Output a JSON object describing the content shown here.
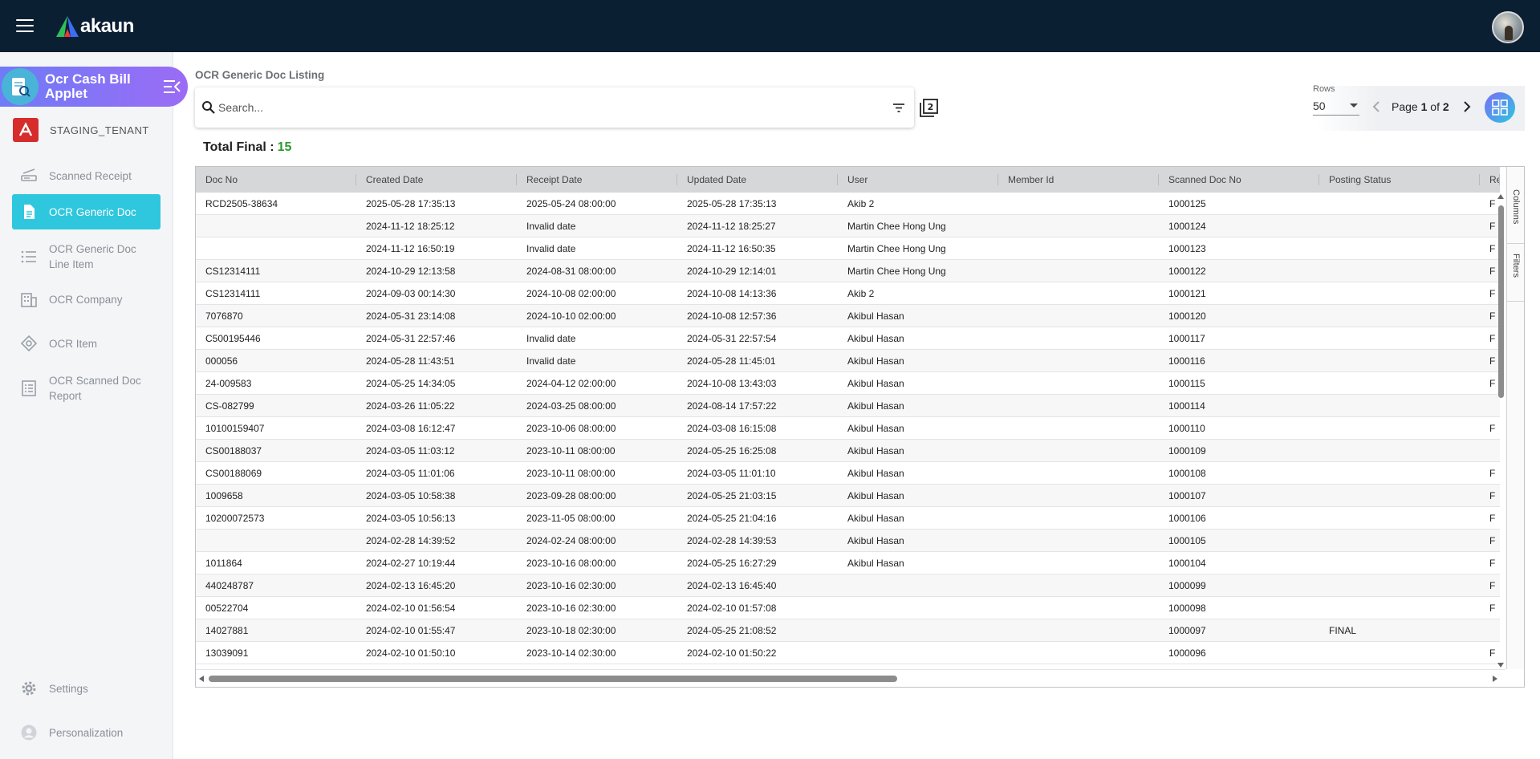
{
  "topbar": {
    "brand": "akaun",
    "colors": {
      "background": "#0b1f33",
      "accent": "#2ec7de"
    }
  },
  "sidebar": {
    "applet_title": "Ocr Cash Bill Applet",
    "tenant": "STAGING_TENANT",
    "items": [
      {
        "label": "Scanned Receipt",
        "icon": "scanner-icon"
      },
      {
        "label": "OCR Generic Doc",
        "icon": "document-icon",
        "active": true
      },
      {
        "label": "OCR Generic Doc Line Item",
        "icon": "list-icon"
      },
      {
        "label": "OCR Company",
        "icon": "building-icon"
      },
      {
        "label": "OCR Item",
        "icon": "item-icon"
      },
      {
        "label": "OCR Scanned Doc Report",
        "icon": "report-icon"
      }
    ],
    "bottom": [
      {
        "label": "Settings",
        "icon": "gear-icon"
      },
      {
        "label": "Personalization",
        "icon": "person-icon"
      }
    ]
  },
  "main": {
    "page_title": "OCR Generic Doc Listing",
    "search_placeholder": "Search...",
    "rows_label": "Rows",
    "rows_value": "50",
    "page_prefix": "Page",
    "page_current": "1",
    "page_of": "of",
    "page_total": "2",
    "total_final_label": "Total Final :",
    "total_final_count": "15"
  },
  "grid": {
    "columns": [
      "Doc No",
      "Created Date",
      "Receipt Date",
      "Updated Date",
      "User",
      "Member Id",
      "Scanned Doc No",
      "Posting Status",
      "Rea"
    ],
    "side_tabs": {
      "columns": "Columns",
      "filters": "Filters"
    },
    "rows": [
      [
        "RCD2505-38634",
        "2025-05-28 17:35:13",
        "2025-05-24 08:00:00",
        "2025-05-28 17:35:13",
        "Akib 2",
        "",
        "1000125",
        "",
        "F"
      ],
      [
        "",
        "2024-11-12 18:25:12",
        "Invalid date",
        "2024-11-12 18:25:27",
        "Martin Chee Hong Ung",
        "",
        "1000124",
        "",
        "F"
      ],
      [
        "",
        "2024-11-12 16:50:19",
        "Invalid date",
        "2024-11-12 16:50:35",
        "Martin Chee Hong Ung",
        "",
        "1000123",
        "",
        "F"
      ],
      [
        "CS12314111",
        "2024-10-29 12:13:58",
        "2024-08-31 08:00:00",
        "2024-10-29 12:14:01",
        "Martin Chee Hong Ung",
        "",
        "1000122",
        "",
        "F"
      ],
      [
        "CS12314111",
        "2024-09-03 00:14:30",
        "2024-10-08 02:00:00",
        "2024-10-08 14:13:36",
        "Akib 2",
        "",
        "1000121",
        "",
        "F"
      ],
      [
        "7076870",
        "2024-05-31 23:14:08",
        "2024-10-10 02:00:00",
        "2024-10-08 12:57:36",
        "Akibul Hasan",
        "",
        "1000120",
        "",
        "F"
      ],
      [
        "C500195446",
        "2024-05-31 22:57:46",
        "Invalid date",
        "2024-05-31 22:57:54",
        "Akibul Hasan",
        "",
        "1000117",
        "",
        "F"
      ],
      [
        "000056",
        "2024-05-28 11:43:51",
        "Invalid date",
        "2024-05-28 11:45:01",
        "Akibul Hasan",
        "",
        "1000116",
        "",
        "F"
      ],
      [
        "24-009583",
        "2024-05-25 14:34:05",
        "2024-04-12 02:00:00",
        "2024-10-08 13:43:03",
        "Akibul Hasan",
        "",
        "1000115",
        "",
        "F"
      ],
      [
        "CS-082799",
        "2024-03-26 11:05:22",
        "2024-03-25 08:00:00",
        "2024-08-14 17:57:22",
        "Akibul Hasan",
        "",
        "1000114",
        "",
        ""
      ],
      [
        "10100159407",
        "2024-03-08 16:12:47",
        "2023-10-06 08:00:00",
        "2024-03-08 16:15:08",
        "Akibul Hasan",
        "",
        "1000110",
        "",
        "F"
      ],
      [
        "CS00188037",
        "2024-03-05 11:03:12",
        "2023-10-11 08:00:00",
        "2024-05-25 16:25:08",
        "Akibul Hasan",
        "",
        "1000109",
        "",
        ""
      ],
      [
        "CS00188069",
        "2024-03-05 11:01:06",
        "2023-10-11 08:00:00",
        "2024-03-05 11:01:10",
        "Akibul Hasan",
        "",
        "1000108",
        "",
        "F"
      ],
      [
        "1009658",
        "2024-03-05 10:58:38",
        "2023-09-28 08:00:00",
        "2024-05-25 21:03:15",
        "Akibul Hasan",
        "",
        "1000107",
        "",
        "F"
      ],
      [
        "10200072573",
        "2024-03-05 10:56:13",
        "2023-11-05 08:00:00",
        "2024-05-25 21:04:16",
        "Akibul Hasan",
        "",
        "1000106",
        "",
        "F"
      ],
      [
        "",
        "2024-02-28 14:39:52",
        "2024-02-24 08:00:00",
        "2024-02-28 14:39:53",
        "Akibul Hasan",
        "",
        "1000105",
        "",
        "F"
      ],
      [
        "1011864",
        "2024-02-27 10:19:44",
        "2023-10-16 08:00:00",
        "2024-05-25 16:27:29",
        "Akibul Hasan",
        "",
        "1000104",
        "",
        "F"
      ],
      [
        "440248787",
        "2024-02-13 16:45:20",
        "2023-10-16 02:30:00",
        "2024-02-13 16:45:40",
        "",
        "",
        "1000099",
        "",
        "F"
      ],
      [
        "00522704",
        "2024-02-10 01:56:54",
        "2023-10-16 02:30:00",
        "2024-02-10 01:57:08",
        "",
        "",
        "1000098",
        "",
        "F"
      ],
      [
        "14027881",
        "2024-02-10 01:55:47",
        "2023-10-18 02:30:00",
        "2024-05-25 21:08:52",
        "",
        "",
        "1000097",
        "FINAL",
        ""
      ],
      [
        "13039091",
        "2024-02-10 01:50:10",
        "2023-10-14 02:30:00",
        "2024-02-10 01:50:22",
        "",
        "",
        "1000096",
        "",
        "F"
      ]
    ]
  }
}
